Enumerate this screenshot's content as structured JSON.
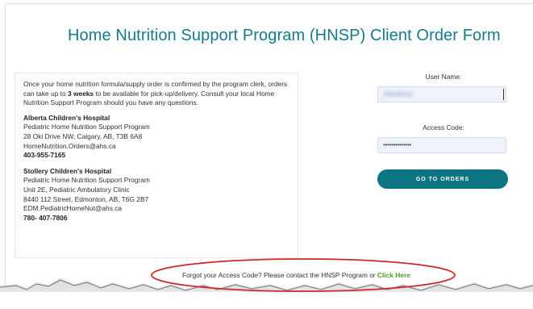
{
  "header": {
    "title": "Home Nutrition Support Program (HNSP) Client Order Form"
  },
  "info": {
    "intro_before": "Once your home nutrition formula/supply order is confirmed by the program clerk, orders can take up to ",
    "intro_bold": "3 weeks",
    "intro_after": " to be available for pick-up/delivery. Consult your local Home Nutrition Support Program should you have any questions.",
    "hospitals": [
      {
        "name": "Alberta Children's Hospital",
        "lines": [
          "Pediatric Home Nutrition Support Program",
          "28 Oki Drive NW, Calgary, AB, T3B 6A8",
          "HomeNutrition.Orders@ahs.ca"
        ],
        "phone": "403-955-7165"
      },
      {
        "name": "Stollery Children's Hospital",
        "lines": [
          "Pediatric Home Nutrition Support Program",
          "Unit 2E, Pediatric Ambulatory Clinic",
          "8440 112 Street, Edmonton, AB, T6G 2B7",
          "EDM.PediatricHomeNut@ahs.ca"
        ],
        "phone": "780- 407-7806"
      }
    ]
  },
  "form": {
    "username_label": "User Name:",
    "username_value": "Jdanahmrs",
    "access_label": "Access Code:",
    "access_value": "••••••••••••••",
    "submit_label": "GO TO ORDERS"
  },
  "footer": {
    "forgot_text": "Forgot your Access Code? Please contact the HNSP Program or ",
    "forgot_link": "Click Here"
  },
  "colors": {
    "title": "#127c8a",
    "button": "#0c7483",
    "link": "#4e9b2e",
    "highlight": "#cc2a2a"
  }
}
